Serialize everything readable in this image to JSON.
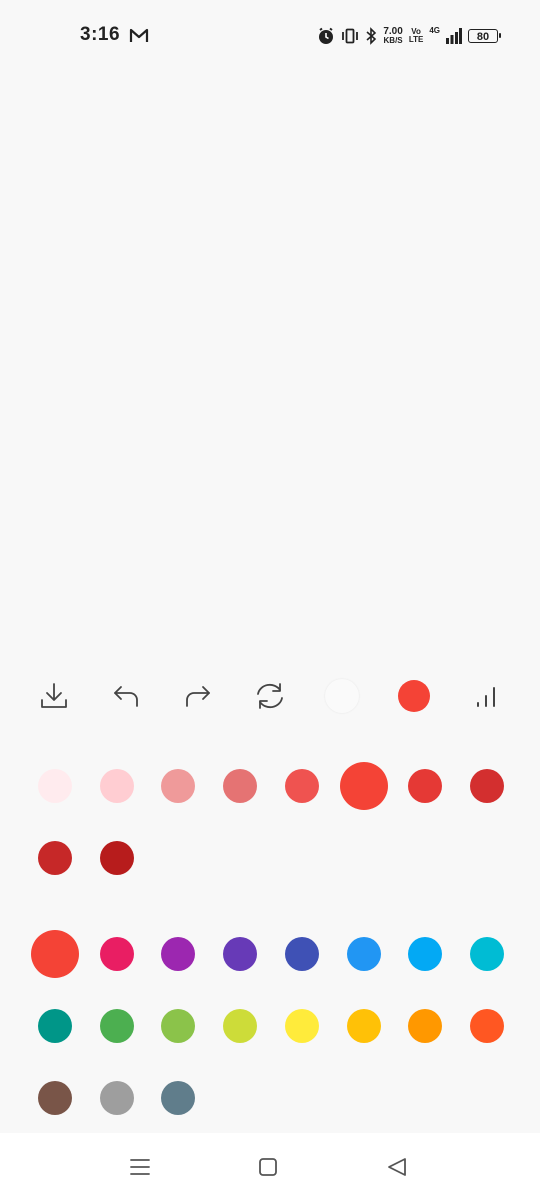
{
  "status_bar": {
    "time": "3:16",
    "net_speed_value": "7.00",
    "net_speed_unit": "KB/S",
    "volte_top": "Vo",
    "volte_bottom": "LTE",
    "network_type": "4G",
    "battery_level": "80"
  },
  "toolbar": {
    "tools": [
      "download-icon",
      "undo-icon",
      "redo-icon",
      "reset-icon",
      "eraser-tool",
      "current-color",
      "brush-size-icon"
    ],
    "current_color": "#f44336"
  },
  "shades": {
    "base_color": "#f44336",
    "colors": [
      "#ffebee",
      "#ffcdd2",
      "#ef9a9a",
      "#e57373",
      "#ef5350",
      "#f44336",
      "#e53935",
      "#d32f2f",
      "#c62828",
      "#b71c1c"
    ],
    "selected": "#f44336"
  },
  "palette": {
    "colors": [
      "#f44336",
      "#e91e63",
      "#9c27b0",
      "#673ab7",
      "#3f51b5",
      "#2196f3",
      "#03a9f4",
      "#00bcd4",
      "#009688",
      "#4caf50",
      "#8bc34a",
      "#cddc39",
      "#ffeb3b",
      "#ffc107",
      "#ff9800",
      "#ff5722",
      "#795548",
      "#9e9e9e",
      "#607d8b"
    ],
    "selected": "#f44336"
  },
  "nav_bar": {
    "buttons": [
      "recent-apps-icon",
      "home-icon",
      "back-icon"
    ]
  }
}
